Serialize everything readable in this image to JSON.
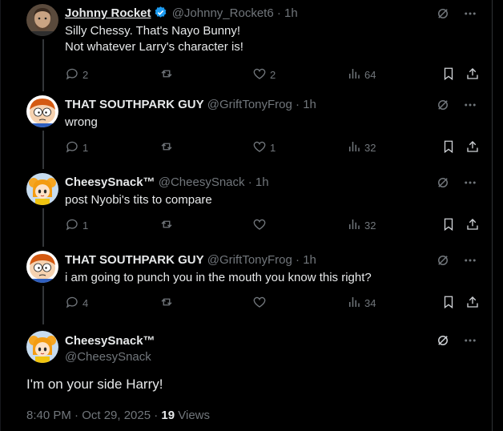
{
  "colors": {
    "background": "#000000",
    "text": "#e7e9ea",
    "muted": "#71767b",
    "verified": "#1d9bf0"
  },
  "replies": [
    {
      "name": "Johnny Rocket",
      "handle": "@Johnny_Rocket6",
      "dot": "·",
      "time": "1h",
      "verified": true,
      "avatar": "man-photo-avatar",
      "lines": [
        "Silly Chessy. That's Nayo Bunny!",
        "Not whatever Larry's character is!"
      ],
      "replies": "2",
      "reposts": "",
      "likes": "2",
      "views": "64"
    },
    {
      "name": "THAT SOUTHPARK GUY",
      "handle": "@GriftTonyFrog",
      "dot": "·",
      "time": "1h",
      "verified": false,
      "avatar": "south-park-avatar",
      "lines": [
        "wrong"
      ],
      "replies": "1",
      "reposts": "",
      "likes": "1",
      "views": "32"
    },
    {
      "name": "CheesySnack™",
      "handle": "@CheesySnack",
      "dot": "·",
      "time": "1h",
      "verified": false,
      "avatar": "anime-girl-avatar",
      "lines": [
        "post Nyobi's tits to compare"
      ],
      "replies": "1",
      "reposts": "",
      "likes": "",
      "views": "32"
    },
    {
      "name": "THAT SOUTHPARK GUY",
      "handle": "@GriftTonyFrog",
      "dot": "·",
      "time": "1h",
      "verified": false,
      "avatar": "south-park-avatar",
      "lines": [
        "i am going to punch you in the mouth you know this right?"
      ],
      "replies": "4",
      "reposts": "",
      "likes": "",
      "views": "34"
    }
  ],
  "main_post": {
    "name": "CheesySnack™",
    "handle": "@CheesySnack",
    "text": "I'm on your side Harry!",
    "timestamp": "8:40 PM · Oct 29, 2025 · ",
    "views_count": "19",
    "views_label": " Views"
  }
}
